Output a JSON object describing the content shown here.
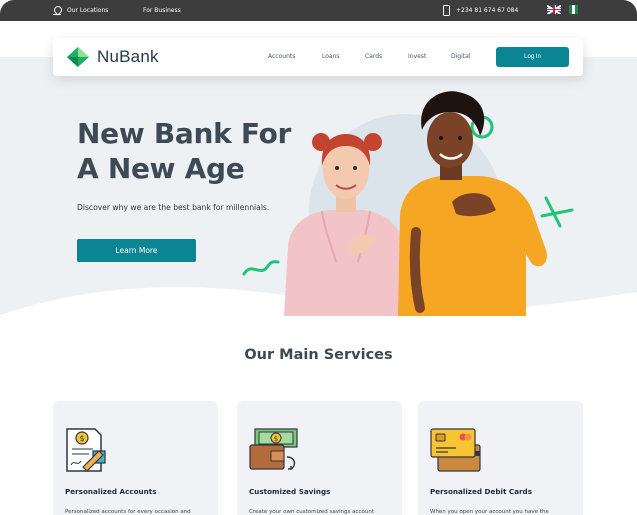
{
  "topbar": {
    "locations_label": "Our Locations",
    "business_label": "For Business",
    "phone": "+234 81 674 67 084",
    "icons": [
      "location-pin-icon",
      "phone-icon",
      "uk-flag-icon",
      "nigeria-flag-icon"
    ]
  },
  "navbar": {
    "brand": "NuBank",
    "links": [
      "Accounts",
      "Loans",
      "Cards",
      "Invest",
      "Digital"
    ],
    "login_label": "Log In"
  },
  "hero": {
    "headline_line1": "New Bank For",
    "headline_line2": "A New Age",
    "subtext": "Discover why we are the best bank for millennials.",
    "cta_label": "Learn More"
  },
  "services": {
    "title": "Our Main Services",
    "cards": [
      {
        "title": "Personalized Accounts",
        "desc": "Personalized accounts for every occasion and",
        "icon": "document-coin-icon"
      },
      {
        "title": "Customized Savings",
        "desc": "Create your own customized savings account",
        "icon": "wallet-cash-icon"
      },
      {
        "title": "Personalized Debit Cards",
        "desc": "When you open your account you have the",
        "icon": "credit-cards-icon"
      }
    ]
  },
  "colors": {
    "accent": "#0b8494",
    "topbar": "#3d3d3d",
    "hero_bg": "#eef1f4",
    "decor_green": "#1fc37a",
    "heading": "#3d4a56"
  }
}
